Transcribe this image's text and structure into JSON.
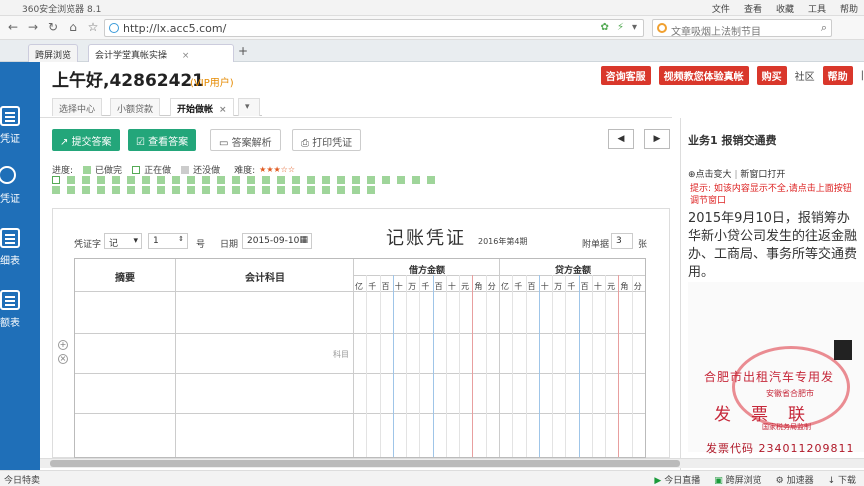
{
  "browser": {
    "title": "360安全浏览器 8.1",
    "menu": [
      "文件",
      "查看",
      "收藏",
      "工具",
      "帮助"
    ],
    "url": "http://lx.acc5.com/",
    "search_placeholder": "文章吸烟上法制节目",
    "tabs": [
      {
        "label": "跨屏浏览"
      },
      {
        "label": "会计学堂真帐实操"
      }
    ],
    "new_tab": "+"
  },
  "sidebar": {
    "items": [
      {
        "label": "凭证"
      },
      {
        "label": "凭证"
      },
      {
        "label": "细表"
      },
      {
        "label": "额表"
      }
    ]
  },
  "header": {
    "greeting": "上午好,42862421",
    "vip": "(VIP用户)",
    "buttons": [
      "咨询客服",
      "视频教您体验真帐",
      "购买",
      "社区",
      "帮助"
    ],
    "subtabs": [
      "选择中心",
      "小额贷款",
      "开始做帐"
    ]
  },
  "toolbar": {
    "submit": "提交答案",
    "view": "查看答案",
    "analysis": "答案解析",
    "print": "打印凭证",
    "prev": "◀",
    "next": "▶"
  },
  "progress": {
    "label": "进度:",
    "done": "已做完",
    "doing": "正在做",
    "todo": "还没做",
    "difficulty": "难度:",
    "difficulty_stars": "★★★☆☆",
    "cells_done": 48,
    "current_index": 0
  },
  "voucher": {
    "title": "记账凭证",
    "word_label": "凭证字",
    "word_value": "记",
    "no_value": "1",
    "no_suffix": "号",
    "date_label": "日期",
    "date_value": "2015-09-10",
    "period": "2016年第4期",
    "attach_label": "附单据",
    "attach_value": "3",
    "attach_suffix": "张",
    "col_summary": "摘要",
    "col_account": "会计科目",
    "col_debit": "借方金额",
    "col_credit": "贷方金额",
    "digits": [
      "亿",
      "千",
      "百",
      "十",
      "万",
      "千",
      "百",
      "十",
      "元",
      "角",
      "分"
    ],
    "account_placeholder": "科目"
  },
  "right_panel": {
    "title": "业务1 报销交通费",
    "zoom_link": "点击变大",
    "new_window_link": "新窗口打开",
    "hint": "提示: 如该内容显示不全,请点击上面按钮调节窗口",
    "description": "2015年9月10日，报销筹办华新小贷公司发生的往返金融办、工商局、事务所等交通费用。",
    "receipt_line1": "合肥市出租汽车专用发",
    "receipt_line2": "安徽省合肥市",
    "receipt_line3": "发票联",
    "receipt_line4": "国家税务局监制",
    "receipt_line5": "发票代码 234011209811"
  },
  "statusbar": {
    "left": "今日特卖",
    "right": [
      "今日直播",
      "跨屏浏览",
      "加速器",
      "下载"
    ]
  }
}
